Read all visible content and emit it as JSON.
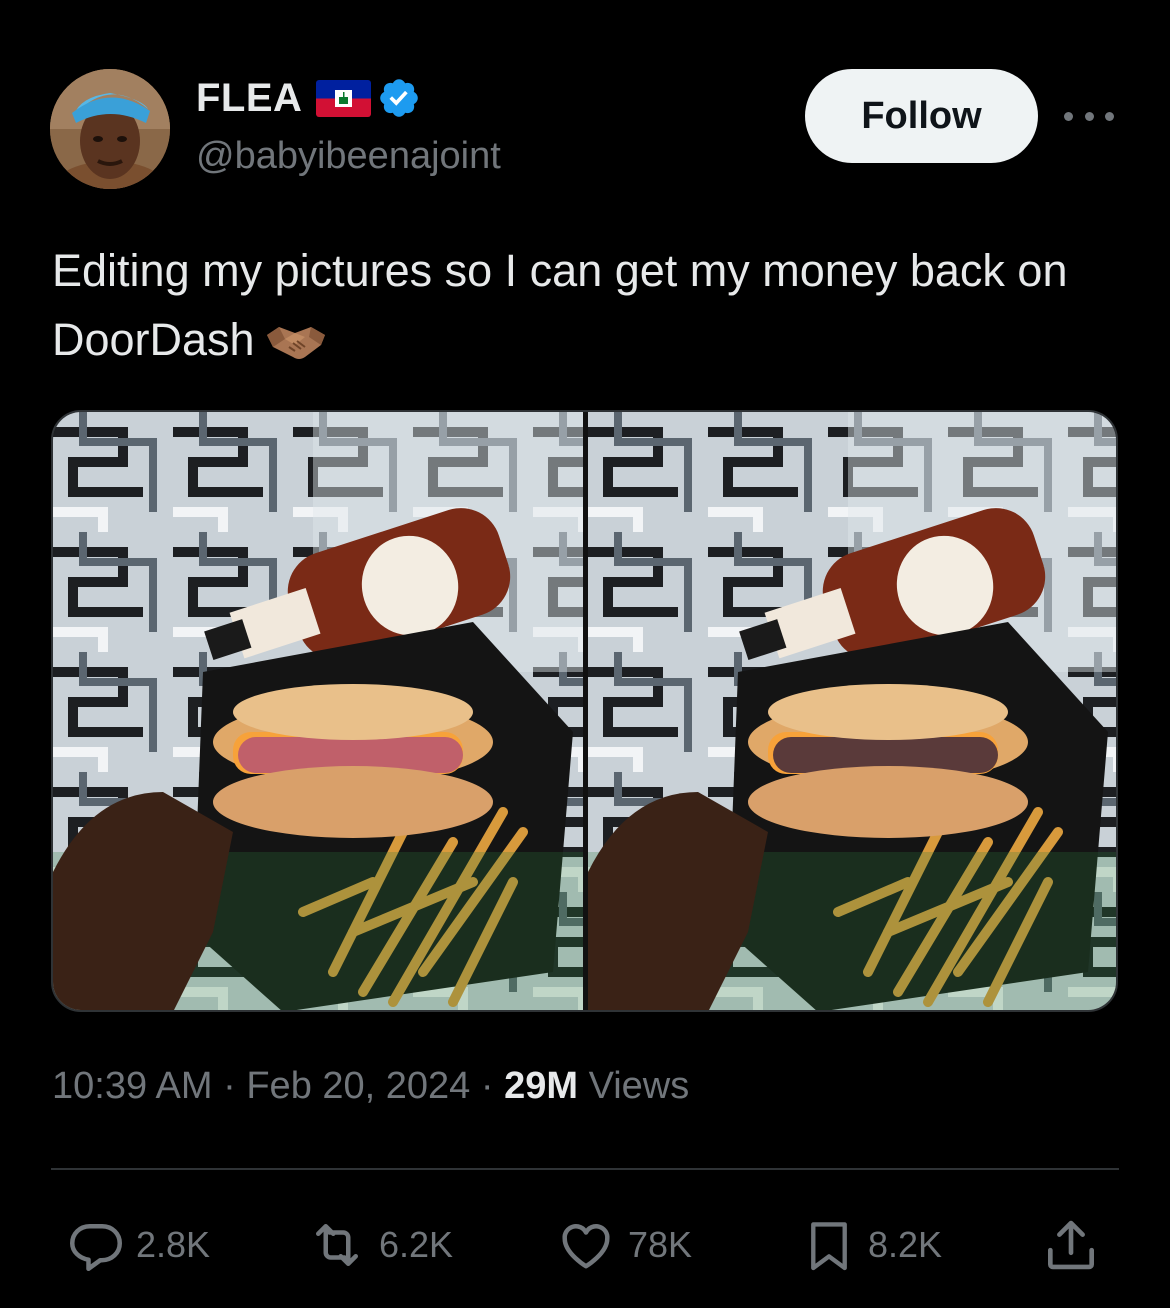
{
  "author": {
    "display_name": "FLEA",
    "handle": "@babyibeenajoint",
    "flag_icon": "haiti-flag-icon",
    "verified_icon": "verified-badge-icon",
    "verified_color": "#1d9bf0"
  },
  "follow_label": "Follow",
  "tweet": {
    "text": "Editing my pictures so I can get my money back on DoorDash",
    "emoji_icon": "handshake-icon"
  },
  "media": {
    "images": [
      {
        "label": "burger photo original"
      },
      {
        "label": "burger photo edited"
      }
    ]
  },
  "meta": {
    "time": "10:39 AM",
    "sep1": " · ",
    "date": "Feb 20, 2024",
    "sep2": " · ",
    "views_count": "29M",
    "views_label": " Views"
  },
  "actions": {
    "replies": "2.8K",
    "reposts": "6.2K",
    "likes": "78K",
    "bookmarks": "8.2K"
  },
  "colors": {
    "background": "#000000",
    "text_primary": "#e7e9ea",
    "text_secondary": "#71767b",
    "follow_bg": "#eff3f4",
    "divider": "#2f3336"
  }
}
